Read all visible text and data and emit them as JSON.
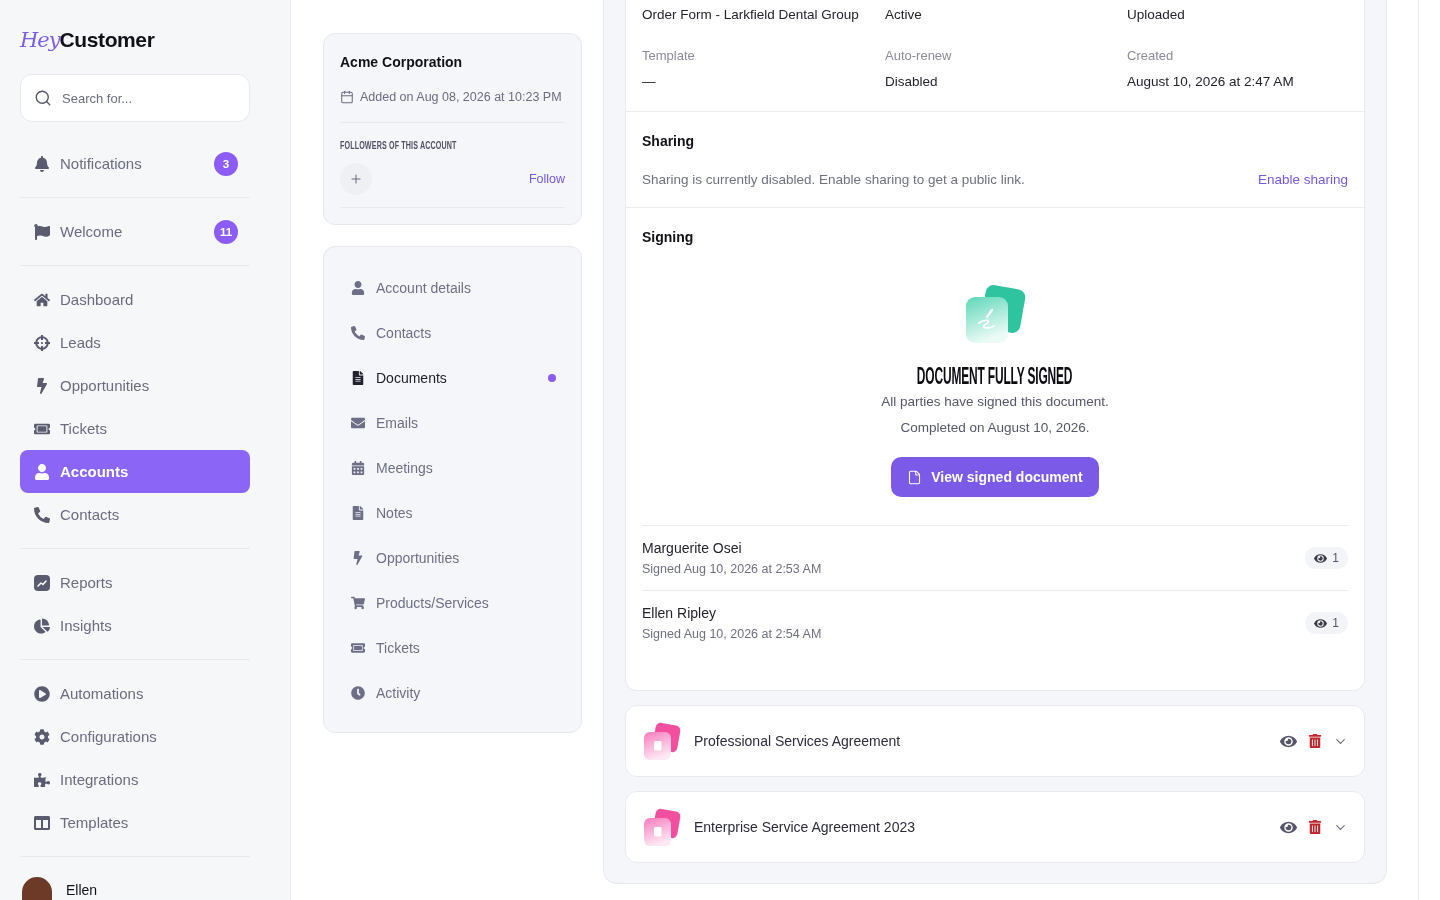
{
  "logo": {
    "mark": "Hey",
    "name": "Customer"
  },
  "search": {
    "placeholder": "Search for..."
  },
  "sidebar": {
    "groups": [
      {
        "items": [
          {
            "label": "Notifications",
            "badge": "3",
            "selected": false
          }
        ]
      },
      {
        "items": [
          {
            "label": "Welcome",
            "badge": "11",
            "selected": false
          }
        ]
      },
      {
        "items": [
          {
            "label": "Dashboard",
            "selected": false
          },
          {
            "label": "Leads",
            "selected": false
          },
          {
            "label": "Opportunities",
            "selected": false
          },
          {
            "label": "Tickets",
            "selected": false
          },
          {
            "label": "Accounts",
            "selected": true
          },
          {
            "label": "Contacts",
            "selected": false
          }
        ]
      },
      {
        "items": [
          {
            "label": "Reports",
            "selected": false
          },
          {
            "label": "Insights",
            "selected": false
          }
        ]
      },
      {
        "items": [
          {
            "label": "Automations",
            "selected": false
          },
          {
            "label": "Configurations",
            "selected": false
          },
          {
            "label": "Integrations",
            "selected": false
          },
          {
            "label": "Templates",
            "selected": false
          }
        ]
      }
    ],
    "user": {
      "name": "Ellen"
    }
  },
  "account": {
    "name": "Acme Corporation",
    "added": "Added on Aug 08, 2026 at 10:23 PM",
    "followers_heading": "FOLLOWERS OF THIS ACCOUNT",
    "follow_link": "Follow"
  },
  "account_nav": [
    {
      "label": "Account details",
      "selected": false
    },
    {
      "label": "Contacts",
      "selected": false
    },
    {
      "label": "Documents",
      "selected": true
    },
    {
      "label": "Emails",
      "selected": false
    },
    {
      "label": "Meetings",
      "selected": false
    },
    {
      "label": "Notes",
      "selected": false
    },
    {
      "label": "Opportunities",
      "selected": false
    },
    {
      "label": "Products/Services",
      "selected": false
    },
    {
      "label": "Tickets",
      "selected": false
    },
    {
      "label": "Activity",
      "selected": false
    }
  ],
  "document": {
    "fields": [
      {
        "value": "Order Form - Larkfield Dental Group"
      },
      {
        "value": "Active"
      },
      {
        "value": "Uploaded"
      },
      {
        "label": "Template",
        "value": "—"
      },
      {
        "label": "Auto-renew",
        "value": "Disabled"
      },
      {
        "label": "Created",
        "value": "August 10, 2026 at 2:47 AM"
      }
    ],
    "sharing": {
      "title": "Sharing",
      "text": "Sharing is currently disabled. Enable sharing to get a public link.",
      "link": "Enable sharing"
    },
    "signing": {
      "title": "Signing",
      "heading": "DOCUMENT FULLY SIGNED",
      "lines": [
        "All parties have signed this document.",
        "Completed on August 10, 2026."
      ],
      "button": "View signed document",
      "signers": [
        {
          "name": "Marguerite Osei",
          "signed": "Signed Aug 10, 2026 at 2:53 AM",
          "views": "1"
        },
        {
          "name": "Ellen Ripley",
          "signed": "Signed Aug 10, 2026 at 2:54 AM",
          "views": "1"
        }
      ]
    }
  },
  "other_documents": [
    {
      "title": "Professional Services Agreement"
    },
    {
      "title": "Enterprise Service Agreement 2023"
    }
  ]
}
